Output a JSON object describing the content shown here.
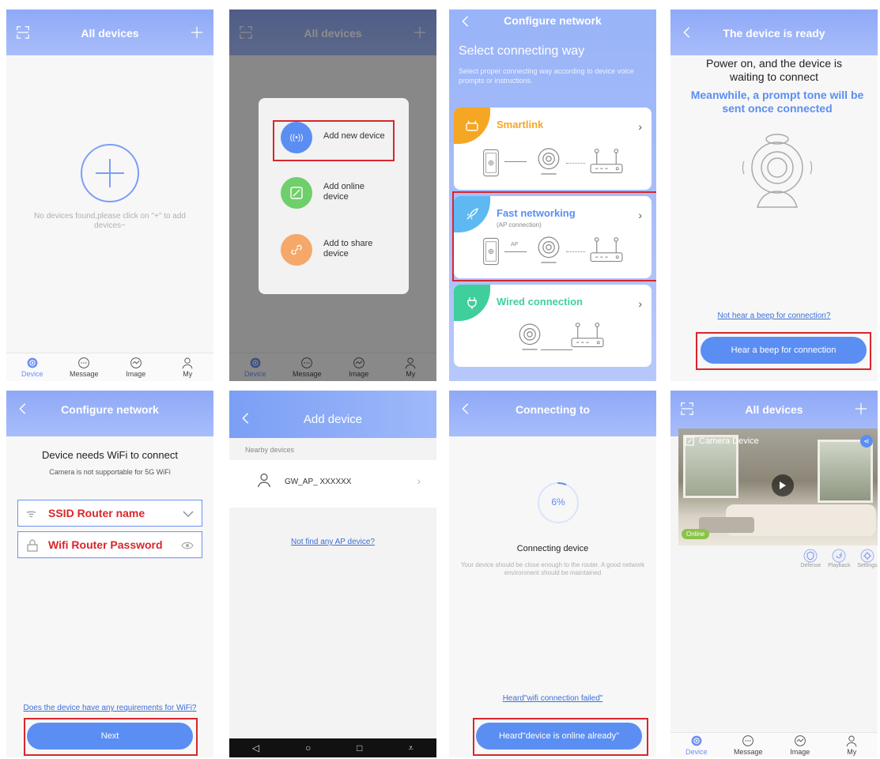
{
  "colors": {
    "accent": "#5b8ef2",
    "navbar": "#98b1f8",
    "highlight": "#d9262b",
    "smartlink": "#f5a623",
    "fast": "#5eb8f2",
    "wired": "#3fcf9c"
  },
  "tabs": [
    "Device",
    "Message",
    "Image",
    "My"
  ],
  "s1": {
    "title": "All devices",
    "empty_text": "No devices found,please click on \"+\" to add devices~"
  },
  "s2": {
    "title": "All devices",
    "menu": [
      {
        "label": "Add new device",
        "icon": "signal-icon"
      },
      {
        "label": "Add online device",
        "icon": "edit-icon"
      },
      {
        "label": "Add to share device",
        "icon": "link-icon"
      }
    ]
  },
  "s3": {
    "title": "Configure network",
    "heading": "Select connecting way",
    "subheading": "Select proper connecting way according to device voice prompts or instructions.",
    "options": [
      {
        "title": "Smartlink",
        "sub": ""
      },
      {
        "title": "Fast networking",
        "sub": "(AP connection)",
        "ap_label": "AP"
      },
      {
        "title": "Wired connection",
        "sub": ""
      }
    ]
  },
  "s4": {
    "title": "The device is ready",
    "line1": "Power on, and the device is waiting to connect",
    "line2": "Meanwhile, a prompt tone will be sent once connected",
    "link": "Not hear a beep for connection?",
    "button": "Hear a beep for connection"
  },
  "s5": {
    "title": "Configure network",
    "heading": "Device needs WiFi to connect",
    "note": "Camera is not supportable for 5G WiFi",
    "ssid_value": "SSID Router name",
    "password_value": "Wifi Router Password",
    "link": "Does the device have any requirements for WiFi?",
    "button": "Next"
  },
  "s6": {
    "title": "Add device",
    "section": "Nearby devices",
    "device_name": "GW_AP_ XXXXXX",
    "link": "Not find any AP device?"
  },
  "s7": {
    "title": "Connecting to",
    "progress": "6%",
    "progress_value": 0.06,
    "status": "Connecting device",
    "note": "Your device should be close enough to the router. A good network environment should be maintained",
    "link": "Heard\"wifi connection failed\"",
    "button": "Heard\"device is online already\""
  },
  "s8": {
    "title": "All devices",
    "device_name": "Camera Device",
    "status": "Online",
    "actions": [
      "Defense",
      "Playback",
      "Settings"
    ]
  }
}
